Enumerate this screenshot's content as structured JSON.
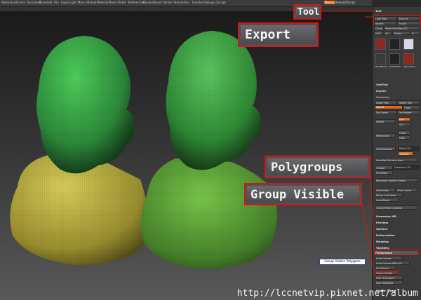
{
  "menu": {
    "items": [
      "Alpha",
      "Brush",
      "Color",
      "Document",
      "Draw",
      "Edit",
      "File",
      "Layer",
      "Light",
      "Macro",
      "Marker",
      "Material",
      "Movie",
      "Picker",
      "Preferences",
      "Render",
      "Stencil",
      "Stroke",
      "Texture",
      "Tool",
      "Transform",
      "Zplugin",
      "Zscript"
    ],
    "right_items": [
      "Menus",
      "DefaultZScript"
    ]
  },
  "callouts": {
    "tool": "Tool",
    "export": "Export",
    "polygroups": "Polygroups",
    "group_visible": "Group Visible"
  },
  "tooltip": "Group Visible Polygons",
  "watermark": "http://lccnetvip.pixnet.net/album",
  "panel": {
    "title": "Tool",
    "load_tool": "Load Tool",
    "save_as": "Save As",
    "import": "Import",
    "export": "Export",
    "clone": "Clone",
    "make_polymesh": "Make PolyMesh3D",
    "goz": "GoZ",
    "all": "All",
    "visible": "Visible",
    "r": "R",
    "subtool": "SubTool",
    "layers": "Layers",
    "geometry": "Geometry",
    "lower_res": "Lower Res",
    "higher_res": "Higher Res",
    "sdiv": "SDiv 6",
    "cage": "Cage",
    "del_lower": "Del Lower",
    "del_higher": "Del Higher",
    "divide": "Divide",
    "smt": "Smt",
    "suv": "Suv",
    "edge_loop": "Edge Loop",
    "crisp": "Crisp",
    "disp": "Disp",
    "groups_loops": "GroupsLoops",
    "polish": "Polish 50",
    "triangle": "Triangle",
    "equalize": "Equalize Surface Area",
    "crease": "Crease",
    "creaselvl": "CreaseLvl 15",
    "uncrease": "Uncrease",
    "reproject": "Reproject Higher Subdiv",
    "deldots": "DelHidden",
    "close_holes": "Close Holes",
    "mirror_weld": "Mirror And Weld",
    "insertmesh": "InsertMesh",
    "check_mesh": "Check Mesh Integrity",
    "geometry_hd": "Geometry HD",
    "preview": "Preview",
    "surface": "Surface",
    "deformation": "Deformation",
    "masking": "Masking",
    "visibility": "Visibility",
    "polygroups": "Polygroups",
    "auto_groups": "Auto Groups",
    "auto_groups_uv": "Auto Groups With UV",
    "uv_groups": "Uv Groups",
    "group_visible": "Group Visible",
    "from_polypaint": "From Polypaint",
    "from_masking": "From Masking",
    "morph_target": "Morph Target",
    "thumb_labels": [
      "SimpleBrush",
      "EraserBrush",
      "Spheredraw"
    ]
  },
  "colors": {
    "accent": "#e06a1a",
    "highlight": "#e01010",
    "head_green": "#3da84a",
    "body_yellow": "#b2a83a"
  }
}
